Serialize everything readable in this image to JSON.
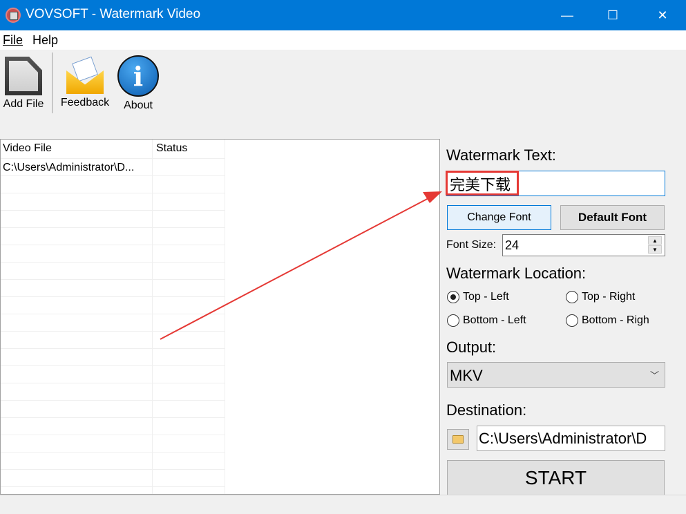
{
  "window": {
    "title": "VOVSOFT - Watermark Video",
    "minimize": "—",
    "maximize": "☐",
    "close": "✕"
  },
  "menu": {
    "file": "File",
    "help": "Help"
  },
  "toolbar": {
    "add_file": "Add File",
    "feedback": "Feedback",
    "about": "About"
  },
  "list": {
    "columns": [
      "Video File",
      "Status"
    ],
    "rows": [
      {
        "file": "C:\\Users\\Administrator\\D...",
        "status": ""
      }
    ]
  },
  "panel": {
    "watermark_text_label": "Watermark Text:",
    "watermark_text_value": "完美下载",
    "change_font": "Change Font",
    "default_font": "Default Font",
    "font_size_label": "Font Size:",
    "font_size_value": "24",
    "location_label": "Watermark Location:",
    "locations": [
      "Top - Left",
      "Top - Right",
      "Bottom - Left",
      "Bottom - Righ"
    ],
    "selected_location": "Top - Left",
    "output_label": "Output:",
    "output_value": "MKV",
    "destination_label": "Destination:",
    "destination_value": "C:\\Users\\Administrator\\D",
    "start": "START"
  },
  "colors": {
    "titlebar": "#0078d7",
    "annotation": "#e53935"
  }
}
